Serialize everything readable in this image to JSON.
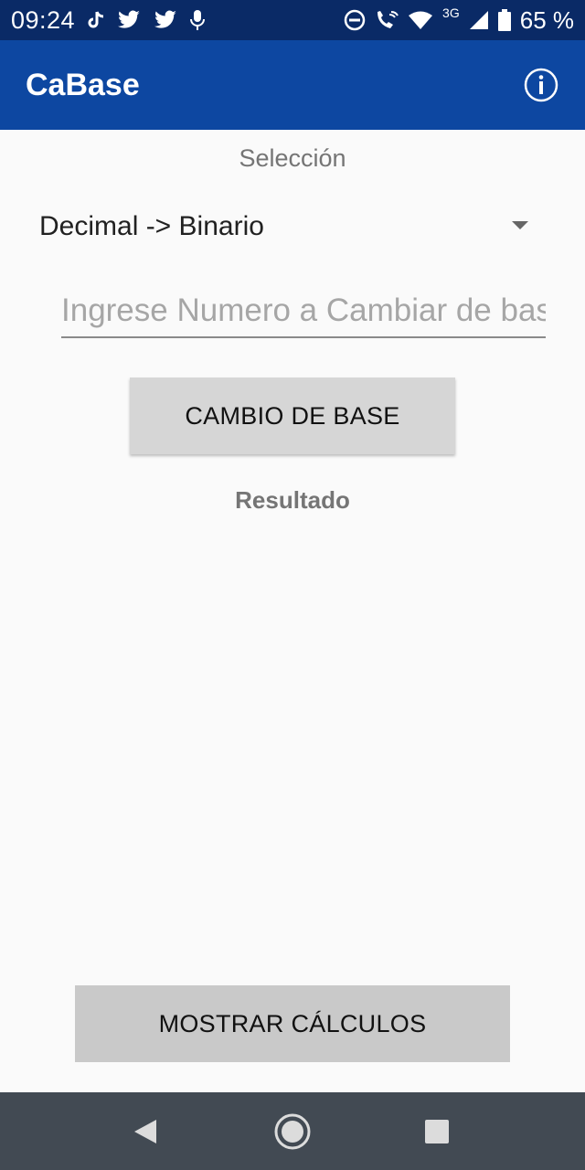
{
  "status_bar": {
    "time": "09:24",
    "network": "3G",
    "battery": "65 %",
    "icons": [
      "tiktok-icon",
      "twitter-icon",
      "twitter-icon",
      "microphone-icon",
      "do-not-disturb-icon",
      "wifi-calling-icon",
      "wifi-icon",
      "cell-signal-icon",
      "battery-icon"
    ]
  },
  "app_bar": {
    "title": "CaBase",
    "info_icon": "info-icon",
    "color": "#0d47a1"
  },
  "form": {
    "selection_label": "Selección",
    "spinner_value": "Decimal -> Binario",
    "input_placeholder": "Ingrese Numero a Cambiar de base",
    "input_value": "",
    "convert_button": "CAMBIO DE BASE",
    "result_label": "Resultado",
    "calcs_button": "MOSTRAR CÁLCULOS"
  },
  "nav_bar": {
    "icons": [
      "back-icon",
      "home-icon",
      "recents-icon"
    ]
  }
}
